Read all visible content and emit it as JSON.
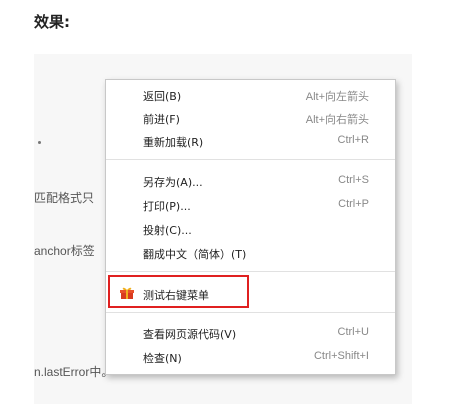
{
  "heading": "效果:",
  "background": {
    "line1": "匹配格式只",
    "line2": "anchor标签",
    "line3": "n.lastError中。"
  },
  "menu": {
    "items": [
      {
        "label": "返回(B)",
        "shortcut": "Alt+向左箭头"
      },
      {
        "label": "前进(F)",
        "shortcut": "Alt+向右箭头"
      },
      {
        "label": "重新加载(R)",
        "shortcut": "Ctrl+R"
      },
      {
        "label": "另存为(A)...",
        "shortcut": "Ctrl+S"
      },
      {
        "label": "打印(P)...",
        "shortcut": "Ctrl+P"
      },
      {
        "label": "投射(C)...",
        "shortcut": ""
      },
      {
        "label": "翻成中文（简体）(T)",
        "shortcut": ""
      },
      {
        "label": "测试右键菜单",
        "shortcut": "",
        "icon": "gift-icon"
      },
      {
        "label": "查看网页源代码(V)",
        "shortcut": "Ctrl+U"
      },
      {
        "label": "检查(N)",
        "shortcut": "Ctrl+Shift+I"
      }
    ]
  },
  "colors": {
    "highlight_border": "#e02020",
    "icon_red": "#d93a1f",
    "icon_gold": "#f0b020"
  }
}
